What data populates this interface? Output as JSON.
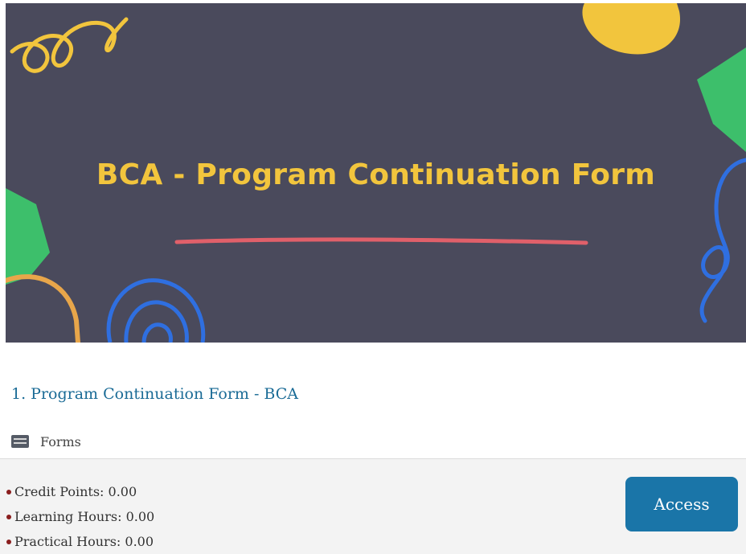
{
  "banner": {
    "title": "BCA - Program Continuation Form"
  },
  "course": {
    "title": "1. Program Continuation Form - BCA",
    "type_label": "Forms",
    "type_icon": "forms-icon",
    "meta": [
      {
        "label": "Credit Points: 0.00"
      },
      {
        "label": "Learning Hours: 0.00"
      },
      {
        "label": "Practical Hours: 0.00"
      }
    ],
    "access_label": "Access"
  },
  "colors": {
    "banner_bg": "#4a4a5c",
    "title_yellow": "#f2c53d",
    "link_blue": "#1a6b96",
    "button_blue": "#1a75a8",
    "bullet_red": "#8a1e1e"
  }
}
